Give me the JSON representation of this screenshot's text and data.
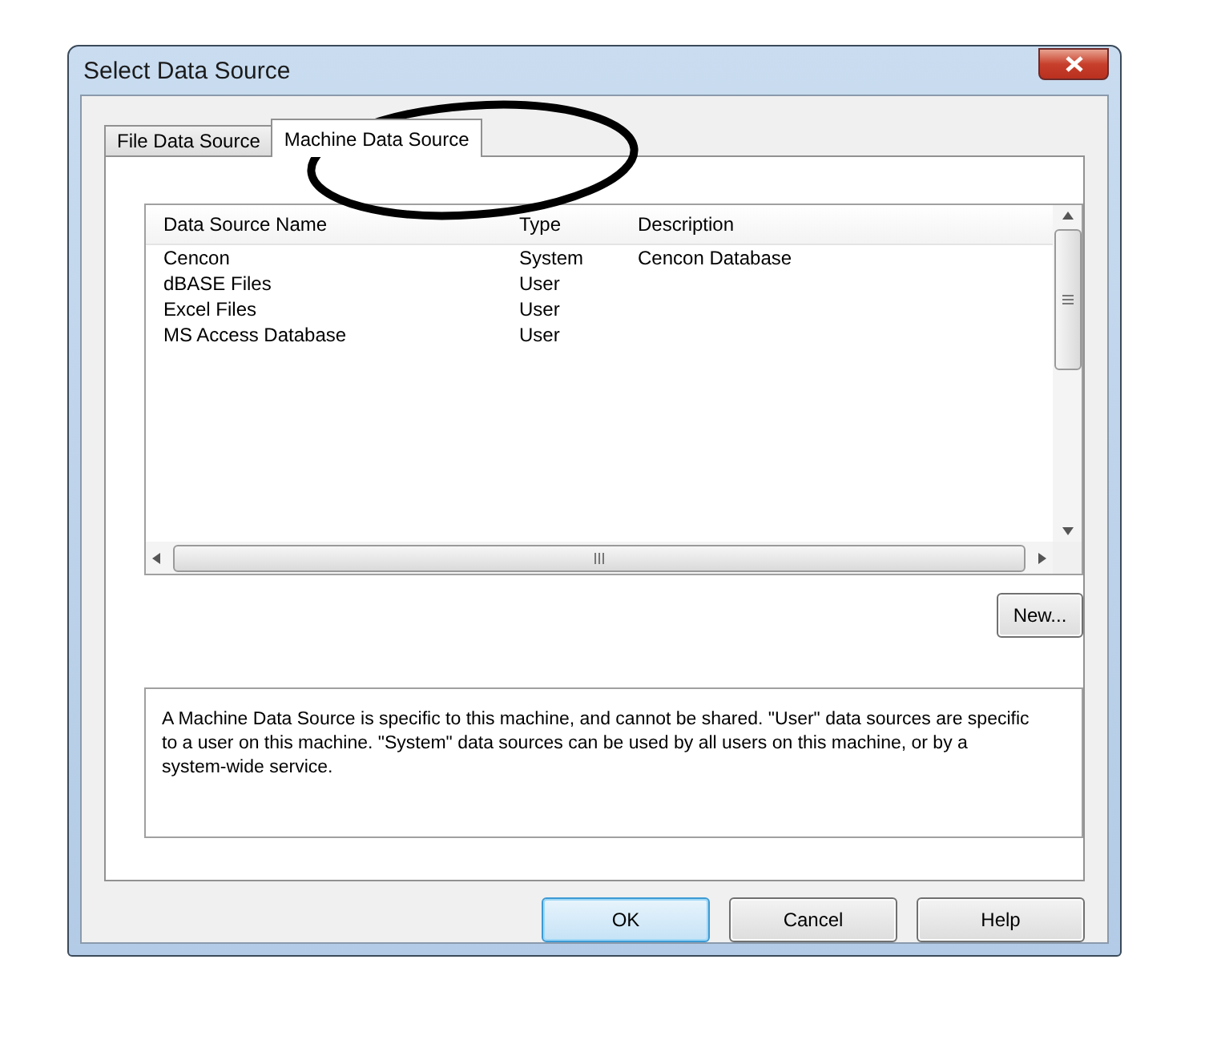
{
  "window": {
    "title": "Select Data Source"
  },
  "tabs": [
    {
      "label": "File Data Source",
      "selected": false
    },
    {
      "label": "Machine Data Source",
      "selected": true
    }
  ],
  "table": {
    "columns": [
      "Data Source Name",
      "Type",
      "Description"
    ],
    "rows": [
      [
        "Cencon",
        "System",
        "Cencon Database"
      ],
      [
        "dBASE Files",
        "User",
        ""
      ],
      [
        "Excel Files",
        "User",
        ""
      ],
      [
        "MS Access Database",
        "User",
        ""
      ]
    ]
  },
  "new_button": "New...",
  "description": "A Machine Data Source is specific to this machine, and cannot be shared. \"User\" data sources are specific to a user on this machine.  \"System\" data sources can be used by all users on this machine, or by a system-wide service.",
  "buttons": [
    {
      "label": "OK",
      "default": true
    },
    {
      "label": "Cancel",
      "default": false
    },
    {
      "label": "Help",
      "default": false
    }
  ]
}
